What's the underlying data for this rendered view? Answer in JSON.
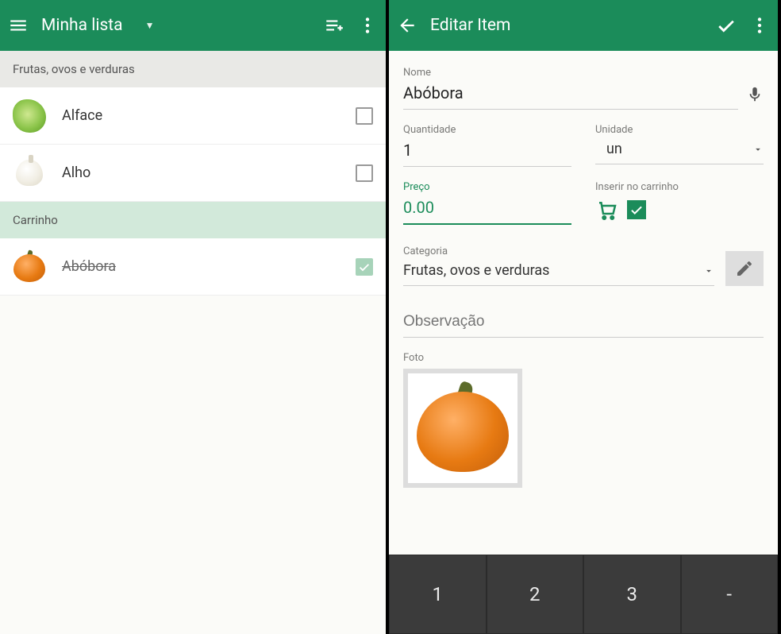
{
  "left": {
    "title": "Minha lista",
    "section1": "Frutas, ovos e verduras",
    "items": [
      {
        "name": "Alface",
        "checked": false
      },
      {
        "name": "Alho",
        "checked": false
      }
    ],
    "cart_header": "Carrinho",
    "cart_items": [
      {
        "name": "Abóbora",
        "checked": true
      }
    ]
  },
  "right": {
    "title": "Editar Item",
    "labels": {
      "nome": "Nome",
      "quantidade": "Quantidade",
      "unidade": "Unidade",
      "preco": "Preço",
      "inserir": "Inserir no carrinho",
      "categoria": "Categoria",
      "foto": "Foto"
    },
    "values": {
      "nome": "Abóbora",
      "quantidade": "1",
      "unidade": "un",
      "preco": "0.00",
      "categoria": "Frutas, ovos e verduras",
      "observacao_placeholder": "Observação",
      "inserir_checked": true
    },
    "keyboard_row": [
      "1",
      "2",
      "3",
      "-"
    ]
  }
}
